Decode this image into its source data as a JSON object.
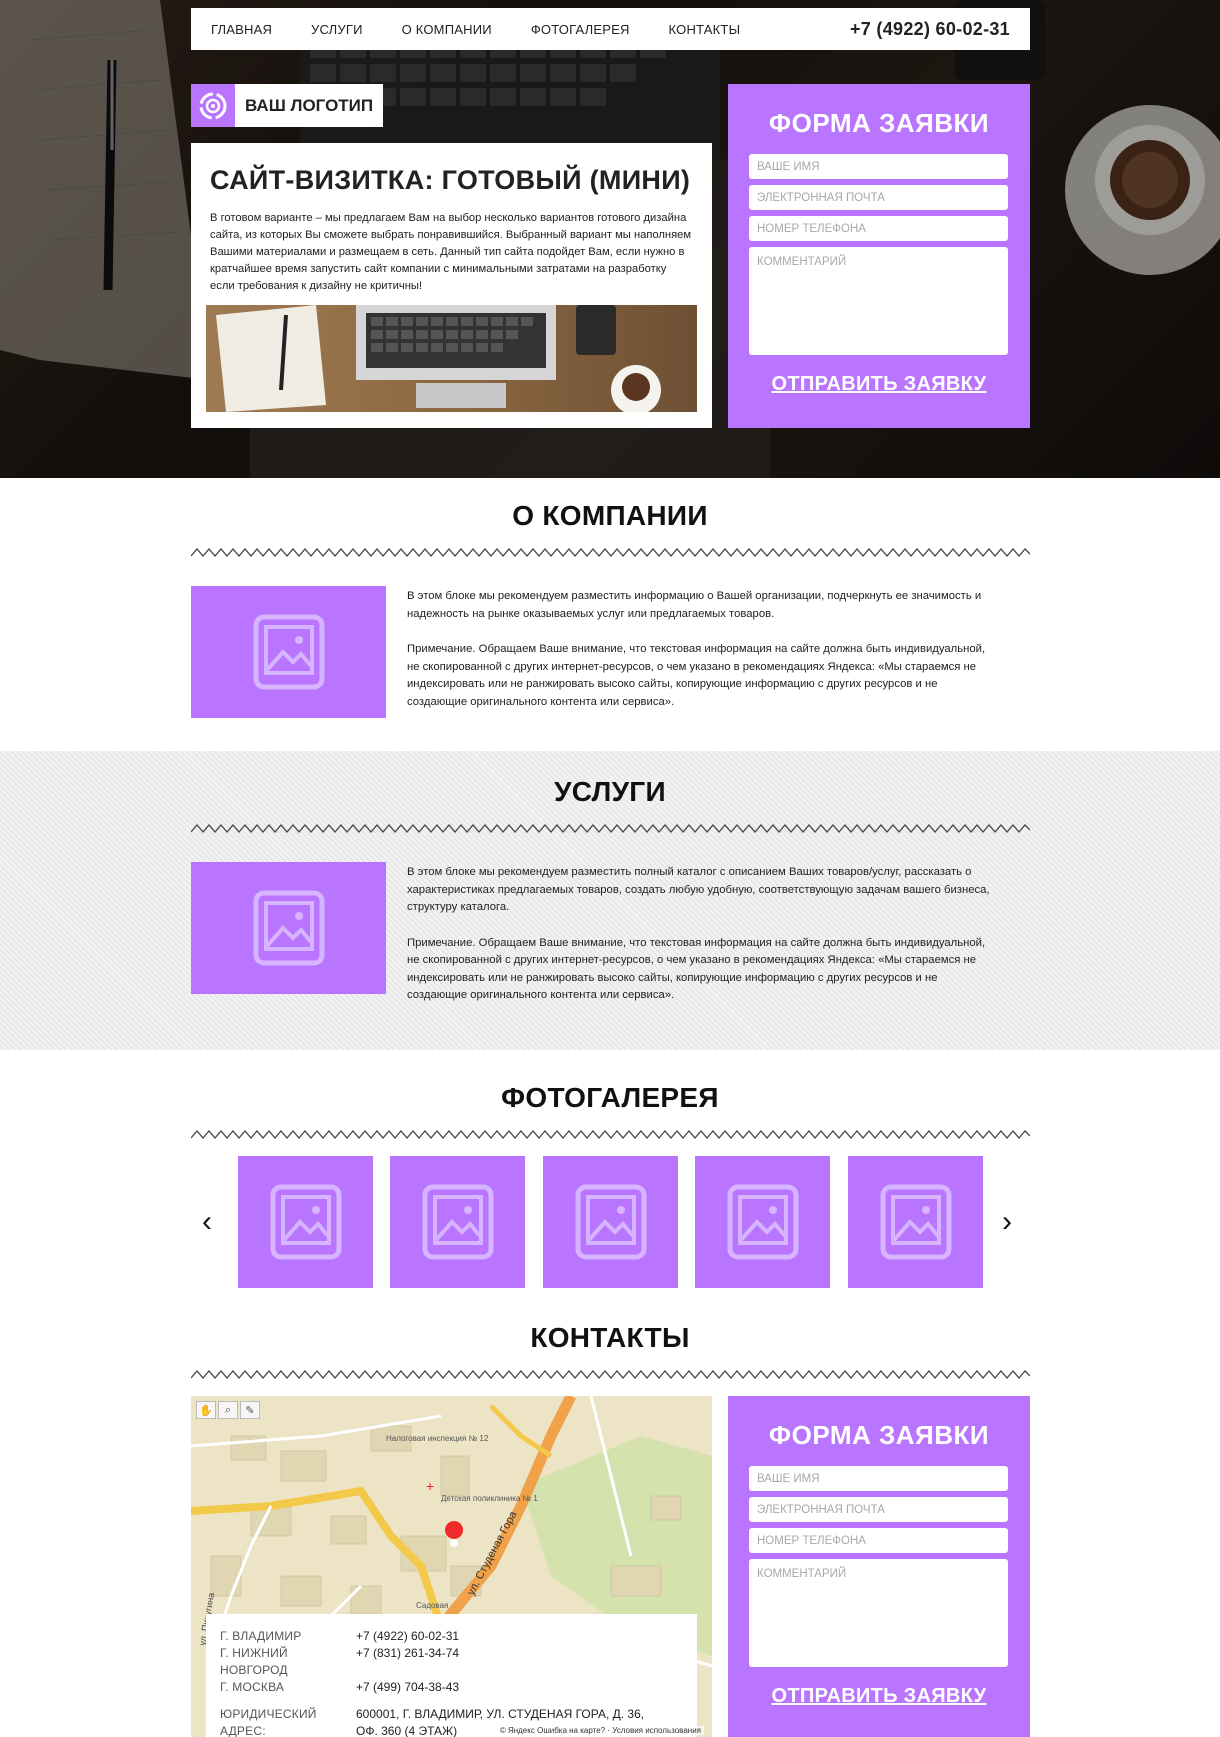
{
  "nav": {
    "items": [
      "ГЛАВНАЯ",
      "УСЛУГИ",
      "О КОМПАНИИ",
      "ФОТОГАЛЕРЕЯ",
      "КОНТАКТЫ"
    ],
    "phone": "+7 (4922) 60-02-31"
  },
  "logo": {
    "text": "ВАШ ЛОГОТИП"
  },
  "intro": {
    "title": "САЙТ-ВИЗИТКА: ГОТОВЫЙ (МИНИ)",
    "text": "В готовом варианте – мы предлагаем Вам на выбор несколько вариантов готового дизайна сайта, из которых Вы сможете выбрать понравившийся. Выбранный вариант мы наполняем Вашими материалами и размещаем в сеть. Данный тип сайта подойдет Вам, если нужно в кратчайшее время запустить сайт компании с минимальными затратами на разработку если требования к дизайну не критичны!"
  },
  "form": {
    "title": "ФОРМА ЗАЯВКИ",
    "name_placeholder": "ВАШЕ ИМЯ",
    "email_placeholder": "ЭЛЕКТРОННАЯ ПОЧТА",
    "phone_placeholder": "НОМЕР ТЕЛЕФОНА",
    "comment_placeholder": "КОММЕНТАРИЙ",
    "submit": "ОТПРАВИТЬ ЗАЯВКУ"
  },
  "about": {
    "title": "О КОМПАНИИ",
    "p1": "В этом блоке мы рекомендуем разместить информацию о Вашей организации, подчеркнуть ее значимость и надежность на рынке оказываемых услуг или предлагаемых товаров.",
    "p2": "Примечание. Обращаем Ваше внимание, что текстовая информация на сайте должна быть индивидуальной, не скопированной с других интернет-ресурсов, о чем указано в рекомендациях Яндекса: «Мы стараемся не индексировать или не ранжировать высоко сайты, копирующие информацию с других ресурсов и не создающие оригинального контента или сервиса»."
  },
  "services": {
    "title": "УСЛУГИ",
    "p1": "В этом блоке мы рекомендуем разместить полный каталог с описанием Ваших товаров/услуг, рассказать о характеристиках предлагаемых товаров, создать любую удобную, соответствующую задачам вашего бизнеса, структуру каталога.",
    "p2": "Примечание. Обращаем Ваше внимание, что текстовая информация на сайте должна быть индивидуальной, не скопированной с других интернет-ресурсов, о чем указано в рекомендациях Яндекса: «Мы стараемся не индексировать или не ранжировать высоко сайты, копирующие информацию с других ресурсов и не создающие оригинального контента или сервиса»."
  },
  "gallery": {
    "title": "ФОТОГАЛЕРЕЯ",
    "prev": "‹",
    "next": "›"
  },
  "contacts": {
    "title": "КОНТАКТЫ",
    "offices": [
      {
        "city": "Г. ВЛАДИМИР",
        "phone": "+7 (4922) 60-02-31"
      },
      {
        "city": "Г. НИЖНИЙ НОВГОРОД",
        "phone": "+7 (831) 261-34-74"
      },
      {
        "city": "Г. МОСКВА",
        "phone": "+7 (499) 704-38-43"
      }
    ],
    "legal_label": "ЮРИДИЧЕСКИЙ АДРЕС:",
    "legal_value": "600001, Г. ВЛАДИМИР, УЛ. СТУДЕНАЯ ГОРА, Д. 36, ОФ. 360 (4 ЭТАЖ)"
  },
  "map": {
    "street_label": "ул. Студеная Гора",
    "street_label_2": "ул. Пичугина",
    "poi_1": "Налоговая инспекция № 12",
    "poi_2": "Детская поликлиника № 1",
    "poi_3": "Садовая",
    "footer_brand": "© Яндекс",
    "footer_link_1": "Ошибка на карте?",
    "footer_link_2": "Условия использования"
  },
  "colors": {
    "accent": "#b975ff",
    "services_bg": "#ededed"
  }
}
